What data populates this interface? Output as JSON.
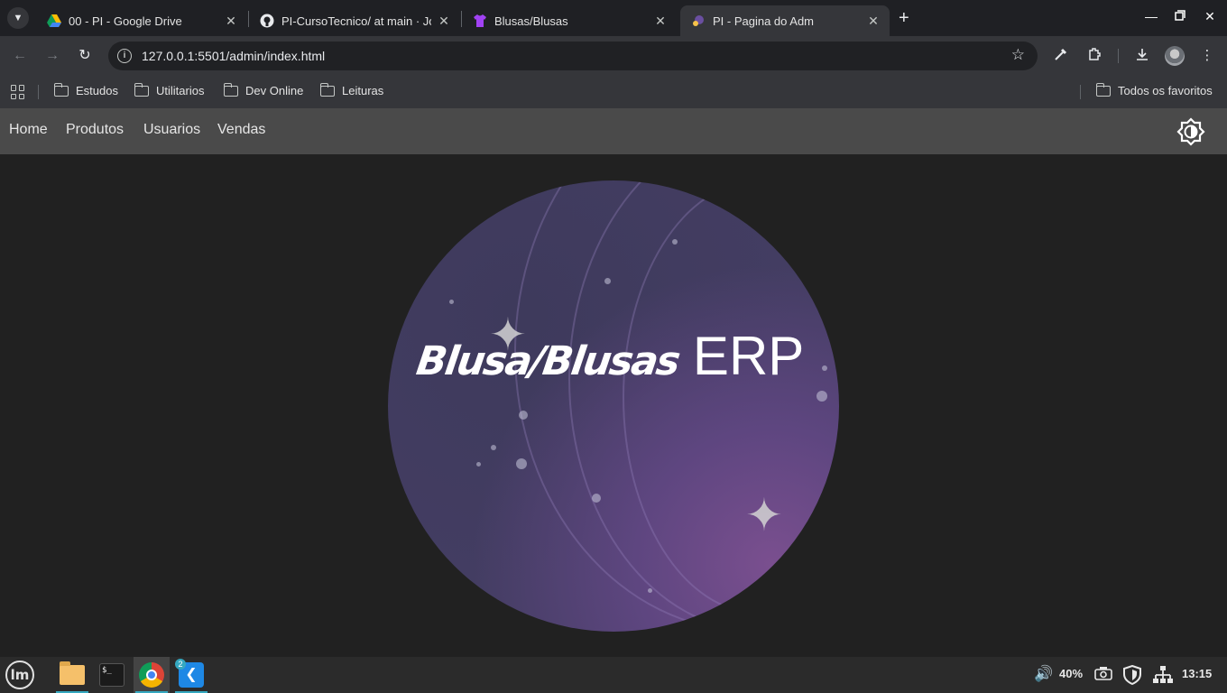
{
  "browser": {
    "tabs": [
      {
        "title": "00 - PI - Google Drive",
        "favicon": "google-drive-icon",
        "active": false
      },
      {
        "title": "PI-CursoTecnico/ at main · Jo",
        "favicon": "github-icon",
        "active": false
      },
      {
        "title": "Blusas/Blusas",
        "favicon": "shirt-icon",
        "active": false
      },
      {
        "title": "PI - Pagina do Adm",
        "favicon": "site-icon",
        "active": true
      }
    ],
    "url": "127.0.0.1:5501/admin/index.html",
    "bookmarks": [
      "Estudos",
      "Utilitarios",
      "Dev Online",
      "Leituras"
    ],
    "all_bookmarks_label": "Todos os favoritos"
  },
  "page": {
    "nav": [
      "Home",
      "Produtos",
      "Usuarios",
      "Vendas"
    ],
    "hero_brand": "Blusa/Blusas",
    "hero_suffix": "ERP"
  },
  "taskbar": {
    "apps": [
      "mint-menu-icon",
      "files-icon",
      "terminal-icon",
      "chrome-icon",
      "vscode-icon"
    ],
    "vscode_badge": "2",
    "volume": "40%",
    "clock": "13:15"
  },
  "colors": {
    "navbar_bg": "#4a4a4a",
    "page_bg": "#212121",
    "hero_purple": "#4b4068"
  }
}
